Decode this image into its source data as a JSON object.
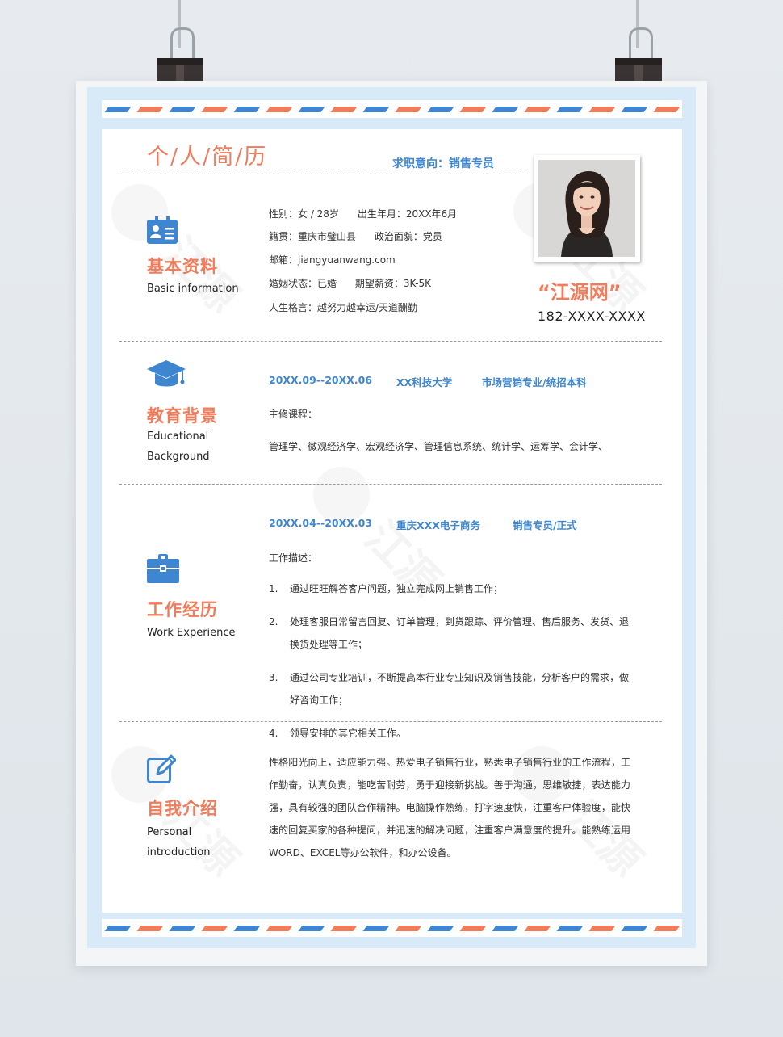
{
  "title": "个/人/简/历",
  "job_target": "求职意向：销售专员",
  "brand": "“江源网”",
  "phone": "182-XXXX-XXXX",
  "watermark": "江源",
  "sections": {
    "basic": {
      "title_cn": "基本资料",
      "title_en": "Basic information",
      "rows": [
        "性别：女 / 28岁      出生年月：20XX年6月",
        "籍贯：重庆市璧山县      政治面貌：党员",
        "邮箱：jiangyuanwang.com",
        "婚姻状态：已婚      期望薪资：3K-5K",
        "人生格言：越努力越幸运/天道酬勤"
      ]
    },
    "education": {
      "title_cn": "教育背景",
      "title_en": "Educational Background",
      "period": "20XX.09--20XX.06",
      "school": "XX科技大学",
      "major": "市场营销专业/统招本科",
      "course_label": "主修课程：",
      "courses": "管理学、微观经济学、宏观经济学、管理信息系统、统计学、运筹学、会计学、"
    },
    "work": {
      "title_cn": "工作经历",
      "title_en": "Work Experience",
      "period": "20XX.04--20XX.03",
      "company": "重庆XXX电子商务",
      "position": "销售专员/正式",
      "desc_label": "工作描述：",
      "items": [
        {
          "num": "1.",
          "text": "通过旺旺解答客户问题，独立完成网上销售工作；"
        },
        {
          "num": "2.",
          "text": "处理客服日常留言回复、订单管理，到货跟踪、评价管理、售后服务、发货、退换货处理等工作；"
        },
        {
          "num": "3.",
          "text": "通过公司专业培训，不断提高本行业专业知识及销售技能，分析客户的需求，做好咨询工作；"
        },
        {
          "num": "4.",
          "text": "领导安排的其它相关工作。"
        }
      ]
    },
    "self": {
      "title_cn": "自我介绍",
      "title_en": "Personal introduction",
      "text": "性格阳光向上，适应能力强。热爱电子销售行业，熟悉电子销售行业的工作流程，工作勤奋，认真负责，能吃苦耐劳，勇于迎接新挑战。善于沟通，思维敏捷，表达能力强，具有较强的团队合作精神。电脑操作熟练，打字速度快，注重客户体验度，能快速的回复买家的各种提问，并迅速的解决问题，注重客户满意度的提升。能熟练运用WORD、EXCEL等办公软件，和办公设备。"
    }
  },
  "colors": {
    "accent_orange": "#f07c5c",
    "accent_blue": "#3e86cf",
    "frame": "#d8e9f7"
  }
}
